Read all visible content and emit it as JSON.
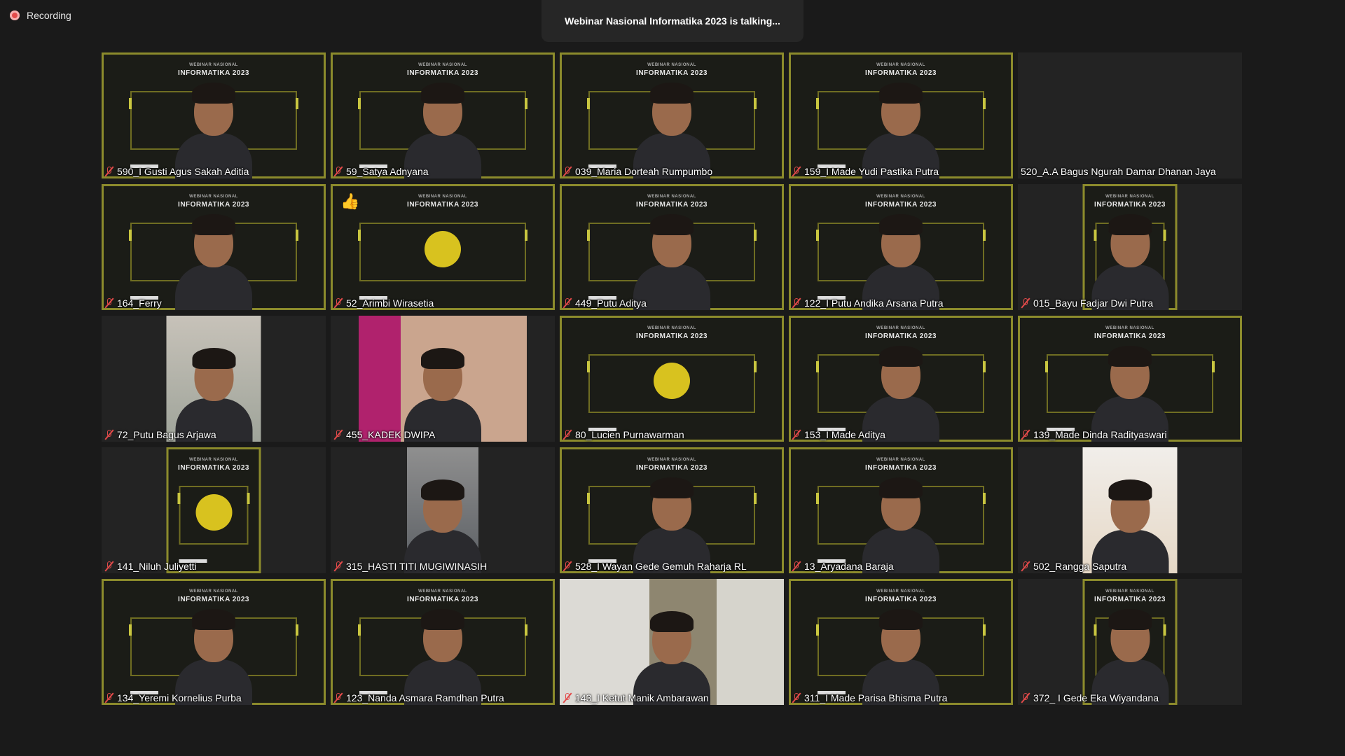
{
  "recording_label": "Recording",
  "speaker_banner": "Webinar Nasional Informatika 2023 is talking...",
  "banner_text": {
    "title_line1": "WEBINAR NASIONAL",
    "title_line2": "INFORMATIKA 2023"
  },
  "participants": [
    {
      "name": "590_I Gusti Agus Sakah Aditia",
      "muted": true,
      "video": "banner-person"
    },
    {
      "name": "59_Satya Adnyana",
      "muted": true,
      "video": "banner-person"
    },
    {
      "name": "039_Maria Dorteah Rumpumbo",
      "muted": true,
      "video": "banner-person"
    },
    {
      "name": "159_I Made Yudi Pastika Putra",
      "muted": true,
      "video": "banner-person"
    },
    {
      "name": "520_A.A Bagus Ngurah Damar Dhanan Jaya",
      "muted": false,
      "video": "none"
    },
    {
      "name": "164_Ferry",
      "muted": true,
      "video": "banner-person"
    },
    {
      "name": "52_Arimbi Wirasetia",
      "muted": true,
      "video": "banner-logo",
      "reaction": "👍"
    },
    {
      "name": "449_Putu Aditya",
      "muted": true,
      "video": "banner-person"
    },
    {
      "name": "122_I Putu Andika Arsana Putra",
      "muted": true,
      "video": "banner-person"
    },
    {
      "name": "015_Bayu Fadjar Dwi Putra",
      "muted": true,
      "video": "banner-logo-narrow"
    },
    {
      "name": "72_Putu Bagus Arjawa",
      "muted": true,
      "video": "camera-narrow"
    },
    {
      "name": "455_KADEK DWIPA",
      "muted": true,
      "video": "camera-wide"
    },
    {
      "name": "80_Lucien Purnawarman",
      "muted": true,
      "video": "banner-logo"
    },
    {
      "name": "153_I Made Aditya",
      "muted": true,
      "video": "banner-person"
    },
    {
      "name": "139_Made Dinda Radityaswari",
      "muted": true,
      "video": "banner-person"
    },
    {
      "name": "141_Niluh Juliyetti",
      "muted": true,
      "video": "banner-logo-narrow"
    },
    {
      "name": "315_HASTI TITI MUGIWINASIH",
      "muted": true,
      "video": "camera-narrow2"
    },
    {
      "name": "528_I Wayan Gede Gemuh Raharja RL",
      "muted": true,
      "video": "banner-person"
    },
    {
      "name": "13_Aryadana Baraja",
      "muted": true,
      "video": "banner-person"
    },
    {
      "name": "502_Rangga Saputra",
      "muted": true,
      "video": "camera-narrow3"
    },
    {
      "name": "134_Yeremi Kornelius Purba",
      "muted": true,
      "video": "banner-person"
    },
    {
      "name": "123_Nanda Asmara Ramdhan Putra",
      "muted": true,
      "video": "banner-person"
    },
    {
      "name": "143_I Ketut Manik Ambarawan",
      "muted": true,
      "video": "camera-full"
    },
    {
      "name": "311_I Made Parisa Bhisma Putra",
      "muted": true,
      "video": "banner-person"
    },
    {
      "name": "372_ I Gede Eka Wiyandana",
      "muted": true,
      "video": "banner-person-narrow"
    }
  ]
}
